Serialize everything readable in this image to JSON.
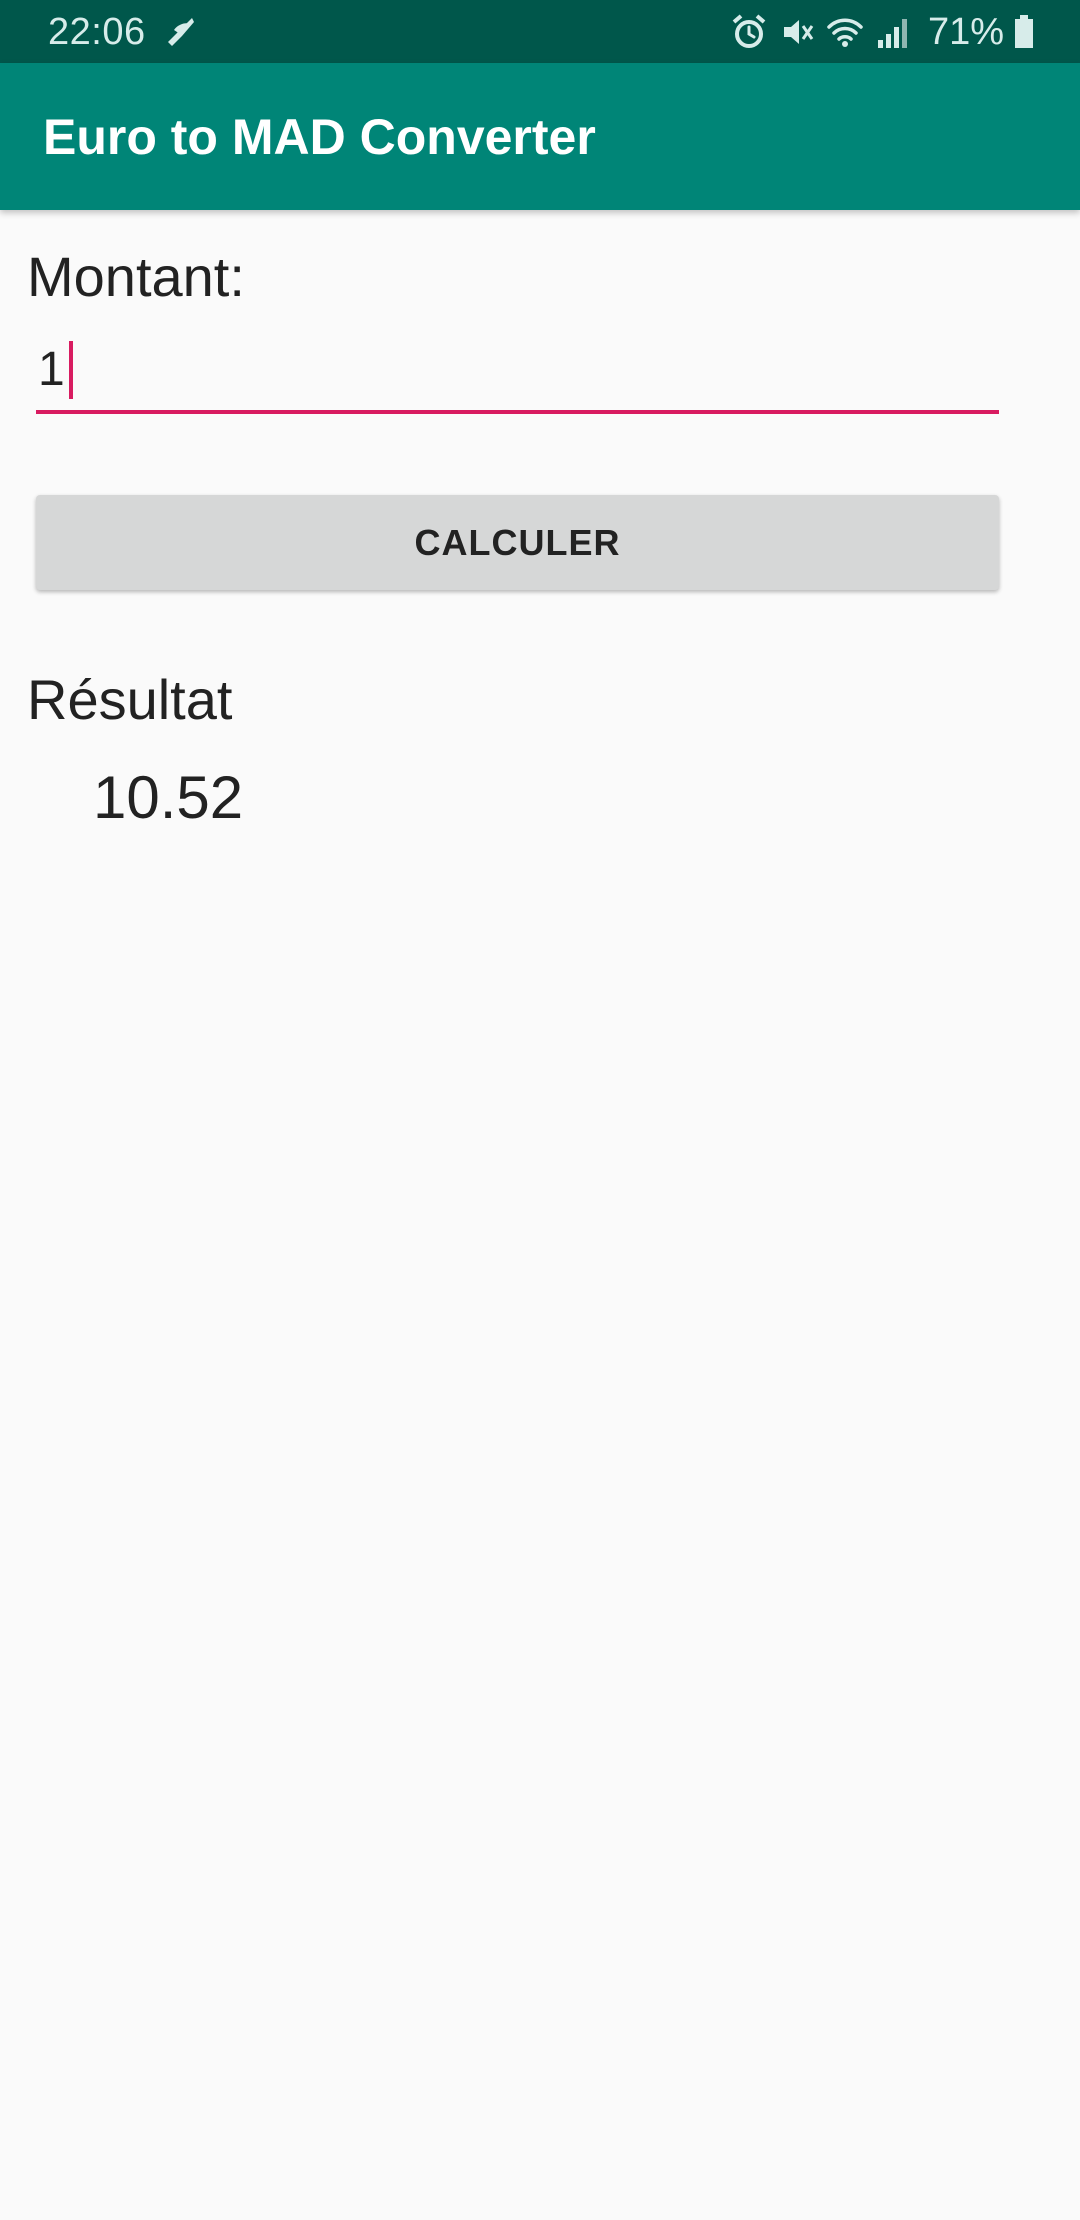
{
  "status_bar": {
    "time": "22:06",
    "battery_percent": "71%",
    "icons": [
      "custom-notification-icon",
      "alarm-icon",
      "mute-icon",
      "wifi-icon",
      "signal-icon",
      "battery-icon"
    ]
  },
  "app_bar": {
    "title": "Euro to MAD Converter",
    "color": "#008577"
  },
  "form": {
    "amount_label": "Montant:",
    "amount_value": "1",
    "calculate_button": "CALCULER",
    "accent_color": "#D81B60"
  },
  "result": {
    "label": "Résultat",
    "value": "10.52"
  }
}
